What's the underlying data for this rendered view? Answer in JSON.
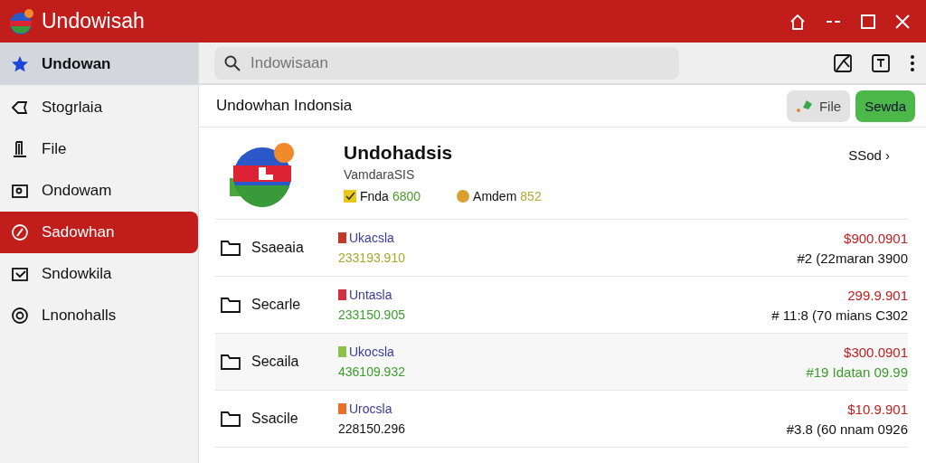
{
  "window": {
    "title": "Undowisah"
  },
  "sidebar": {
    "items": [
      {
        "label": "Undowan",
        "kind": "star",
        "selected": false
      },
      {
        "label": "Stogrlaia",
        "kind": "tag",
        "selected": false
      },
      {
        "label": "File",
        "kind": "file",
        "selected": false
      },
      {
        "label": "Ondowam",
        "kind": "camera",
        "selected": false
      },
      {
        "label": "Sadowhan",
        "kind": "compass",
        "selected": true
      },
      {
        "label": "Sndowkila",
        "kind": "inbox",
        "selected": false
      },
      {
        "label": "Lnonohalls",
        "kind": "at",
        "selected": false
      }
    ]
  },
  "search": {
    "placeholder": "Indowisaan"
  },
  "header": {
    "title": "Undowhan Indonsia",
    "buttons": [
      {
        "label": "File",
        "kind": "secondary"
      },
      {
        "label": "Sewda",
        "kind": "primary"
      }
    ]
  },
  "detail": {
    "name": "Undohadsis",
    "subtitle": "VamdaraSIS",
    "link": "SSod ›",
    "stats": [
      {
        "label": "Fnda",
        "value": "6800",
        "kind": "check"
      },
      {
        "label": "Amdem",
        "value": "852",
        "kind": "coin"
      }
    ]
  },
  "rows": [
    {
      "name": "Ssaeaia",
      "tag": "Ukacsla",
      "color": "#c0392b",
      "number": {
        "text": "233193.910",
        "kind": "olive"
      },
      "amount": "$900.0901",
      "detail": {
        "text": "#2 (22maran 3900",
        "kind": "neutral"
      }
    },
    {
      "name": "Secarle",
      "tag": "Untasla",
      "color": "#d03040",
      "number": {
        "text": "233150.905",
        "kind": "positive"
      },
      "amount": "299.9.901",
      "detail": {
        "text": "# 11:8 (70 mians C302",
        "kind": "neutral"
      }
    },
    {
      "name": "Secaila",
      "tag": "Ukocsla",
      "color": "#8bc34a",
      "number": {
        "text": "436109.932",
        "kind": "positive"
      },
      "amount": "$300.0901",
      "detail": {
        "text": "#19 Idatan 09.99",
        "kind": "positive"
      }
    },
    {
      "name": "Ssacile",
      "tag": "Urocsla",
      "color": "#e8702a",
      "number": {
        "text": "228150.296",
        "kind": "neutral"
      },
      "amount": "$10.9.901",
      "detail": {
        "text": "#3.8 (60 nnam 0926",
        "kind": "neutral"
      }
    }
  ]
}
